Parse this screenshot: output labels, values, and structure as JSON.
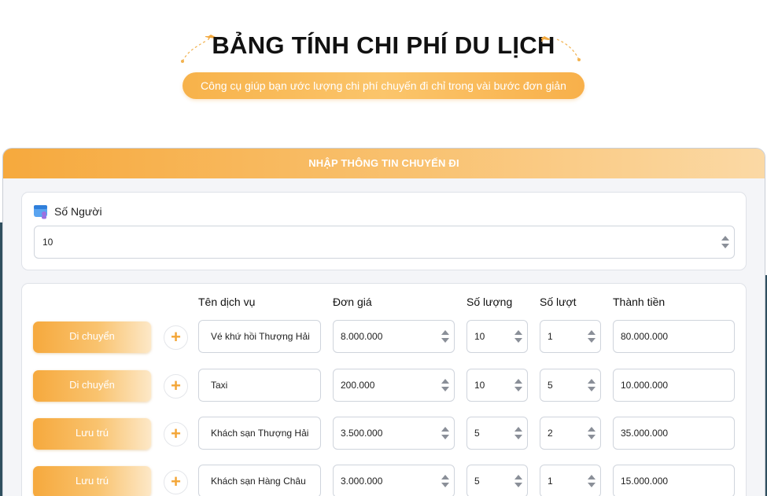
{
  "header": {
    "title": "BẢNG TÍNH CHI PHÍ DU LỊCH",
    "subtitle": "Công cụ giúp bạn ước lượng chi phí chuyến đi chỉ trong vài bước đơn giản"
  },
  "card": {
    "header": "NHẬP THÔNG TIN CHUYẾN ĐI"
  },
  "people": {
    "label": "Số Người",
    "value": "10",
    "icon": "calendar-people-icon"
  },
  "table": {
    "columns": {
      "service": "Tên dịch vụ",
      "price": "Đơn giá",
      "quantity": "Số lượng",
      "trips": "Số lượt",
      "total": "Thành tiền"
    },
    "add_symbol": "+",
    "rows": [
      {
        "category": "Di chuyển",
        "service": "Vé khứ hồi Thượng Hải",
        "price": "8.000.000",
        "quantity": "10",
        "trips": "1",
        "total": "80.000.000"
      },
      {
        "category": "Di chuyển",
        "service": "Taxi",
        "price": "200.000",
        "quantity": "10",
        "trips": "5",
        "total": "10.000.000"
      },
      {
        "category": "Lưu trú",
        "service": "Khách sạn Thượng Hải",
        "price": "3.500.000",
        "quantity": "5",
        "trips": "2",
        "total": "35.000.000"
      },
      {
        "category": "Lưu trú",
        "service": "Khách sạn Hàng Châu",
        "price": "3.000.000",
        "quantity": "5",
        "trips": "1",
        "total": "15.000.000"
      }
    ]
  },
  "colors": {
    "accent": "#f6a93d",
    "accent_light": "#fbd9a5",
    "card_bg": "#f4f5f8"
  }
}
